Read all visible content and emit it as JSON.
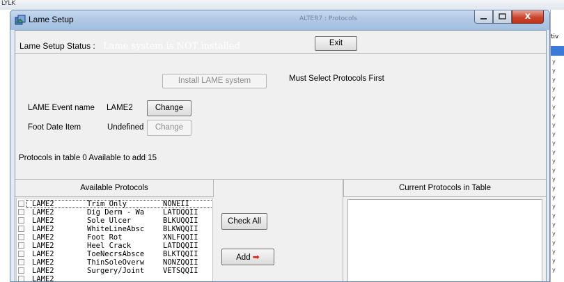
{
  "background": {
    "top_label": "LYLK",
    "right_tab": "tiv",
    "right_rows": [
      "y",
      "y",
      "y",
      "y",
      "y",
      "y",
      "y",
      "y",
      "y",
      "y",
      "y",
      "y",
      "y",
      "y",
      "y",
      "y",
      "y",
      "y",
      "y",
      "y",
      "y",
      "y",
      "y",
      "y"
    ]
  },
  "window": {
    "title": "Lame Setup",
    "behind_title_fragments": [
      "",
      "ALTER7 : Protocols"
    ],
    "close_glyph": "x"
  },
  "status": {
    "label": "Lame Setup Status :",
    "value": "Lame system is NOT installed",
    "exit_label": "Exit"
  },
  "install": {
    "button_label": "Install LAME system",
    "note": "Must Select Protocols First"
  },
  "lame_event": {
    "label": "LAME Event name",
    "value": "LAME2",
    "change_label": "Change"
  },
  "foot_date": {
    "label": "Foot Date Item",
    "value": "Undefined",
    "change_label": "Change"
  },
  "protocols_count_text": "Protocols in table 0 Available to add 15",
  "available": {
    "header": "Available Protocols",
    "rows": [
      {
        "event": "LAME2",
        "name": "Trim Only",
        "code": "NONEII"
      },
      {
        "event": "LAME2",
        "name": "Dig Derm - Wa",
        "code": "LATDQQII"
      },
      {
        "event": "LAME2",
        "name": "Sole Ulcer",
        "code": "BLKUQQII"
      },
      {
        "event": "LAME2",
        "name": "WhiteLineAbsc",
        "code": "BLKWQQII"
      },
      {
        "event": "LAME2",
        "name": "Foot Rot",
        "code": "XNLFQQII"
      },
      {
        "event": "LAME2",
        "name": "Heel Crack",
        "code": "LATDQQII"
      },
      {
        "event": "LAME2",
        "name": "ToeNecrsAbsce",
        "code": "BLKTQQII"
      },
      {
        "event": "LAME2",
        "name": "ThinSoleOverw",
        "code": "NONZQQII"
      },
      {
        "event": "LAME2",
        "name": "Surgery/Joint",
        "code": "VETSQQII"
      },
      {
        "event": "LAME2",
        "name": "",
        "code": ""
      }
    ]
  },
  "actions": {
    "check_all_label": "Check All",
    "add_label": "Add",
    "add_arrow": "➡"
  },
  "current": {
    "header": "Current Protocols in Table",
    "rows": []
  },
  "colors": {
    "status_value": "#ffffff",
    "add_arrow": "#d42a1a",
    "close_button": "#c9462e"
  }
}
